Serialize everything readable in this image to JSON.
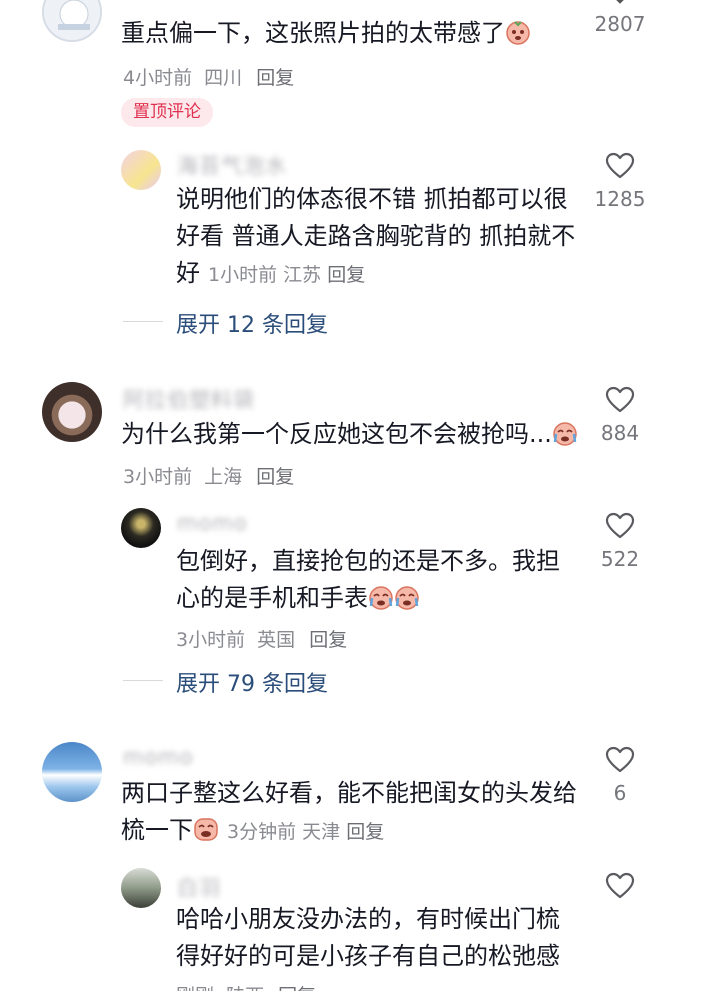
{
  "comments": [
    {
      "text": "重点偏一下，这张照片拍的太带感了",
      "time": "4小时前",
      "location": "四川",
      "reply": "回复",
      "likes": "2807",
      "badge": "置顶评论",
      "replies": [
        {
          "username": "海苔气泡水",
          "text": "说明他们的体态很不错 抓拍都可以很好看 普通人走路含胸驼背的 抓拍就不好",
          "time": "1小时前",
          "location": "江苏",
          "reply": "回复",
          "likes": "1285"
        }
      ],
      "expand": "展开 12 条回复"
    },
    {
      "username": "阿拉伯塑料袋",
      "text": "为什么我第一个反应她这包不会被抢吗...",
      "time": "3小时前",
      "location": "上海",
      "reply": "回复",
      "likes": "884",
      "replies": [
        {
          "username": "momo",
          "text": "包倒好，直接抢包的还是不多。我担心的是手机和手表",
          "time": "3小时前",
          "location": "英国",
          "reply": "回复",
          "likes": "522"
        }
      ],
      "expand": "展开 79 条回复"
    },
    {
      "username": "momo",
      "text": "两口子整这么好看，能不能把闺女的头发给梳一下",
      "time": "3分钟前",
      "location": "天津",
      "reply": "回复",
      "likes": "6",
      "replies": [
        {
          "username": "白羽",
          "text": "哈哈小朋友没办法的，有时候出门梳得好好的可是小孩子有自己的松弛感",
          "time": "刚刚",
          "location": "陕西",
          "reply": "回复",
          "likes": ""
        }
      ]
    }
  ],
  "colors": {
    "pinned_bg": "#fde9ec",
    "pinned_text": "#e0304f",
    "link": "#2b4d7a",
    "meta": "#8a8b91"
  }
}
